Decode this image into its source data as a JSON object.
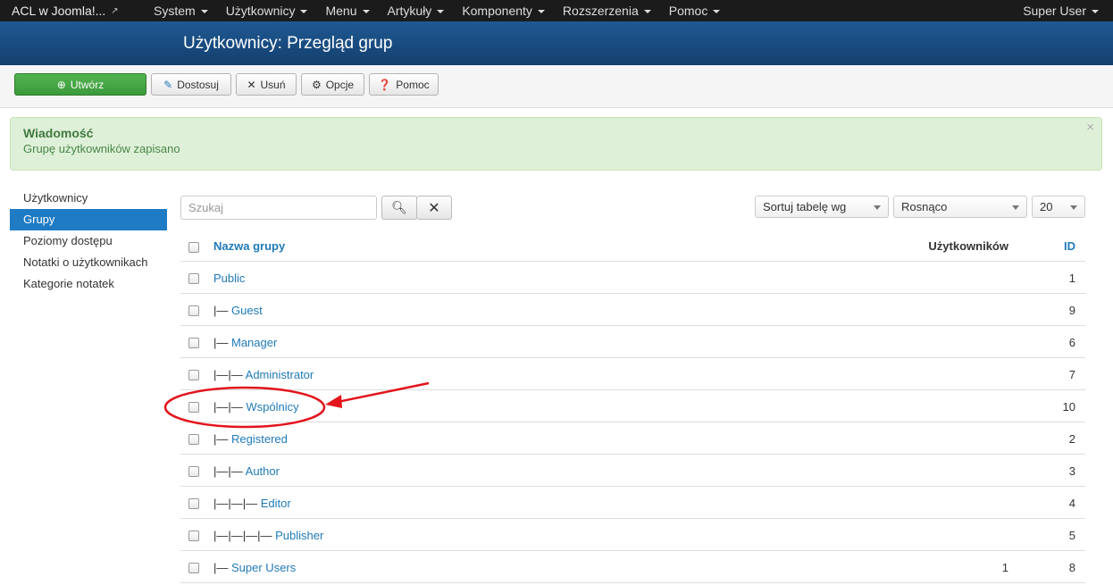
{
  "navbar": {
    "brand": "ACL w Joomla!...",
    "menu": [
      "System",
      "Użytkownicy",
      "Menu",
      "Artykuły",
      "Komponenty",
      "Rozszerzenia",
      "Pomoc"
    ],
    "user": "Super User"
  },
  "title": "Użytkownicy: Przegląd grup",
  "toolbar": {
    "create": "Utwórz",
    "edit": "Dostosuj",
    "delete": "Usuń",
    "options": "Opcje",
    "help": "Pomoc"
  },
  "message": {
    "heading": "Wiadomość",
    "text": "Grupę użytkowników zapisano"
  },
  "sidebar": {
    "items": [
      {
        "label": "Użytkownicy"
      },
      {
        "label": "Grupy"
      },
      {
        "label": "Poziomy dostępu"
      },
      {
        "label": "Notatki o użytkownikach"
      },
      {
        "label": "Kategorie notatek"
      }
    ],
    "active": "Grupy"
  },
  "filters": {
    "search_placeholder": "Szukaj",
    "sort_by": "Sortuj tabelę wg",
    "order": "Rosnąco",
    "limit": "20"
  },
  "table": {
    "headers": {
      "name": "Nazwa grupy",
      "users": "Użytkowników",
      "id": "ID"
    },
    "rows": [
      {
        "prefix": "",
        "name": "Public",
        "users": "",
        "id": "1"
      },
      {
        "prefix": "|— ",
        "name": "Guest",
        "users": "",
        "id": "9"
      },
      {
        "prefix": "|— ",
        "name": "Manager",
        "users": "",
        "id": "6"
      },
      {
        "prefix": "|—|— ",
        "name": "Administrator",
        "users": "",
        "id": "7"
      },
      {
        "prefix": "|—|— ",
        "name": "Wspólnicy",
        "users": "",
        "id": "10"
      },
      {
        "prefix": "|— ",
        "name": "Registered",
        "users": "",
        "id": "2"
      },
      {
        "prefix": "|—|— ",
        "name": "Author",
        "users": "",
        "id": "3"
      },
      {
        "prefix": "|—|—|— ",
        "name": "Editor",
        "users": "",
        "id": "4"
      },
      {
        "prefix": "|—|—|—|— ",
        "name": "Publisher",
        "users": "",
        "id": "5"
      },
      {
        "prefix": "|— ",
        "name": "Super Users",
        "users": "1",
        "id": "8"
      }
    ]
  },
  "colors": {
    "navbar": "#1b1b1b",
    "titlebar": "#1a4f84",
    "accent": "#1e7bc4",
    "success_bg": "#dff0d8",
    "create_button": "#46a846",
    "annotation": "#e3141b"
  }
}
